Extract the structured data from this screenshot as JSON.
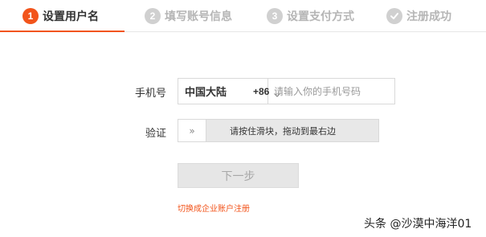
{
  "steps": [
    {
      "num": "1",
      "label": "设置用户名",
      "active": true
    },
    {
      "num": "2",
      "label": "填写账号信息",
      "active": false
    },
    {
      "num": "3",
      "label": "设置支付方式",
      "active": false
    },
    {
      "num": "",
      "label": "注册成功",
      "active": false
    }
  ],
  "form": {
    "phone_label": "手机号",
    "country_name": "中国大陆",
    "country_code": "+86",
    "phone_placeholder": "请输入你的手机号码",
    "phone_value": "",
    "verify_label": "验证",
    "slider_handle_glyph": "»",
    "slider_text": "请按住滑块，拖动到最右边",
    "next_label": "下一步",
    "switch_link": "切换成企业账户注册"
  },
  "watermark": "头条 @沙漠中海洋01",
  "colors": {
    "accent": "#f2541b",
    "inactive_step": "#d0d0d0",
    "disabled_button": "#e6e6e6"
  }
}
